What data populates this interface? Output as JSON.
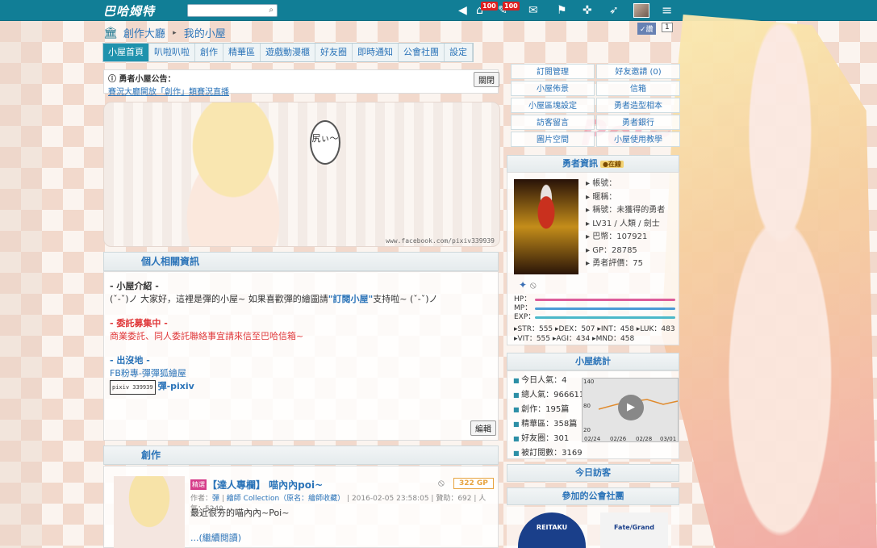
{
  "topbar": {
    "logo": "巴哈姆特",
    "search_placeholder": "",
    "badges": [
      "100",
      "100"
    ],
    "icons": [
      "volume-icon",
      "bell-icon",
      "notification-icon",
      "mail-icon",
      "flag-icon",
      "gamepad-icon",
      "rocket-icon",
      "avatar",
      "menu-icon"
    ]
  },
  "breadcrumb": {
    "root": "創作大廳",
    "sep": "▸",
    "current": "我的小屋"
  },
  "vote": {
    "label": "✓讚",
    "count": "1"
  },
  "tabs": [
    "小屋首頁",
    "叭啦叭啦",
    "創作",
    "精華區",
    "遊戲動漫櫃",
    "好友圈",
    "即時通知",
    "公會社團",
    "設定"
  ],
  "notice": {
    "title": "勇者小屋公告：",
    "link": "賽況大廳開放「創作」類賽況直播",
    "close": "關閉"
  },
  "banner": {
    "bubble": "尻ぃ～",
    "credit": "www.facebook.com/pixiv339939"
  },
  "profile": {
    "header": "個人相關資訊",
    "intro_title": "- 小屋介紹 -",
    "intro_text_a": "(ˇ-ˇ)ノ 大家好，這裡是彈的小屋~ 如果喜歡彈的繪圖請",
    "intro_link": "\"訂閱小屋\"",
    "intro_text_b": "支持啦~ (ˇ-ˇ)ノ",
    "commission_title": "- 委託募集中 -",
    "commission_text": "商業委託、同人委託聯絡事宜請來信至巴哈信箱~",
    "location_title": "- 出沒地 -",
    "fb_link": "FB粉專-彈彈狐繪屋",
    "pixiv_badge": "pixiv 339939",
    "pixiv_link": "彈-pixiv",
    "edit": "編輯"
  },
  "creation": {
    "header": "創作",
    "tag": "精選",
    "title": "【達人專欄】 喵內內poi~",
    "meta_author_label": "作者：",
    "meta_author": "彈",
    "meta_cat": "繪師 Collection（原名：繪師收藏）",
    "meta_date": "2016-02-05 23:58:05",
    "meta_likes": "贊助：692",
    "meta_views": "人氣：5240",
    "desc": "最近很夯的喵內內~Poi~",
    "more": "...(繼續閱讀)",
    "gp": "322 GP"
  },
  "quick_links": [
    "訂閱管理",
    "好友邀請 (0)",
    "小屋佈景",
    "信箱",
    "小屋區塊設定",
    "勇者造型相本",
    "訪客留言",
    "勇者銀行",
    "圖片空間",
    "小屋使用教學"
  ],
  "user": {
    "header": "勇者資訊",
    "online": "●在線",
    "info": [
      "帳號：",
      "暱稱：",
      "稱號：未獲得的勇者",
      "LV31 / 人類 / 劍士",
      "巴幣：107921",
      "GP：28785",
      "勇者評價：75"
    ],
    "hp": "HP：",
    "mp": "MP：",
    "exp": "EXP：",
    "attrs": "▸STR：555 ▸DEX：507 ▸INT：458 ▸LUK：483 ▸VIT：555 ▸AGI：434 ▸MND：458"
  },
  "stats": {
    "header": "小屋統計",
    "items": [
      "今日人氣：4",
      "總人氣：966611",
      "創作：195篇",
      "精華區：358篇",
      "好友圈：301",
      "被訂閱數：3169"
    ],
    "chart_y": [
      "140",
      "80",
      "20"
    ],
    "chart_x": [
      "02/24",
      "02/26",
      "02/28",
      "03/01"
    ]
  },
  "today_visitors": "今日訪客",
  "guilds": {
    "header": "參加的公會社團",
    "items": [
      "REITAKU",
      "Fate/Grand"
    ]
  },
  "watermark": "Poi~"
}
